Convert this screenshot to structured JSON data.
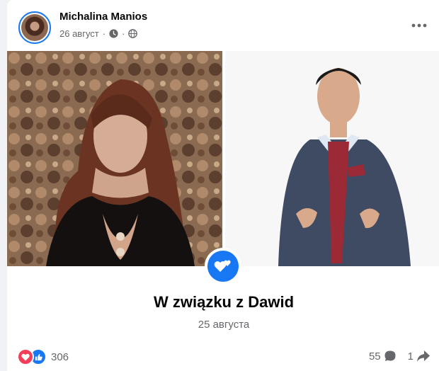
{
  "post": {
    "author_name": "Michalina Manios",
    "timestamp": "26 август",
    "separator": "·",
    "more_icon": "more-dots-icon",
    "privacy_icons": [
      "clock-icon",
      "globe-icon"
    ]
  },
  "relationship": {
    "title": "W związku z Dawid",
    "date": "25 августа",
    "badge_icon": "hearts-icon",
    "badge_color": "#1877f2"
  },
  "footer": {
    "reaction_count": "306",
    "comment_count": "55",
    "share_count": "1",
    "reaction_icons": [
      "love-reaction-icon",
      "like-reaction-icon"
    ]
  },
  "colors": {
    "accent": "#1877f2",
    "love": "#f33e58",
    "secondary_text": "#65676b"
  }
}
